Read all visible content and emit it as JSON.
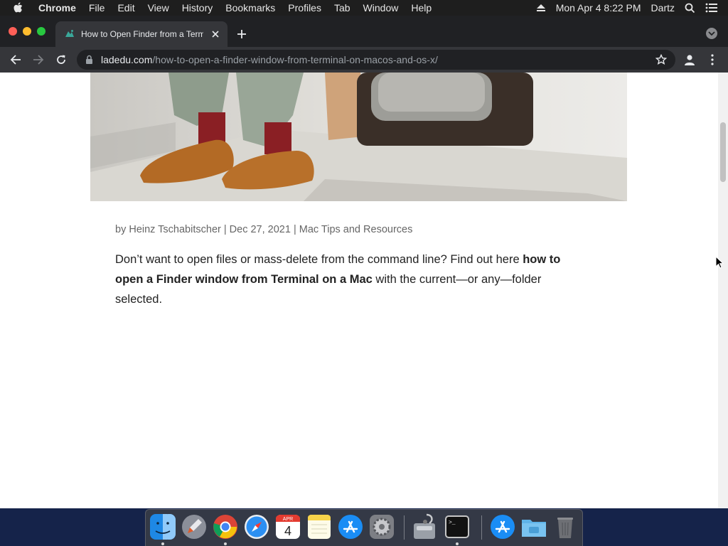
{
  "menubar": {
    "app_name": "Chrome",
    "menus": [
      "File",
      "Edit",
      "View",
      "History",
      "Bookmarks",
      "Profiles",
      "Tab",
      "Window",
      "Help"
    ],
    "clock": "Mon Apr 4  8:22 PM",
    "user": "Dartz"
  },
  "browser": {
    "tab_title": "How to Open Finder from a Terminal Window on macOS and OS X",
    "url_domain": "ladedu.com",
    "url_path": "/how-to-open-a-finder-window-from-terminal-on-macos-and-os-x/"
  },
  "article": {
    "meta_prefix": "by ",
    "author": "Heinz Tschabitscher",
    "separator": " | ",
    "date": "Dec 27, 2021",
    "category": "Mac Tips and Resources",
    "intro_before": "Don’t want to open files or mass-delete from the command line? Find out here ",
    "intro_bold": "how to open a Finder window from Terminal on a Mac",
    "intro_after": " with the current—or any—folder selected."
  },
  "dock": {
    "items": [
      "finder-icon",
      "launchpad-icon",
      "chrome-icon",
      "safari-icon",
      "calendar-icon",
      "notes-icon",
      "app-store-icon",
      "system-preferences-icon",
      "disk-utility-icon",
      "terminal-icon",
      "applications-folder-icon",
      "downloads-folder-icon",
      "trash-icon"
    ],
    "calendar_month": "APR",
    "calendar_day": "4",
    "terminal_prompt": ">_"
  }
}
